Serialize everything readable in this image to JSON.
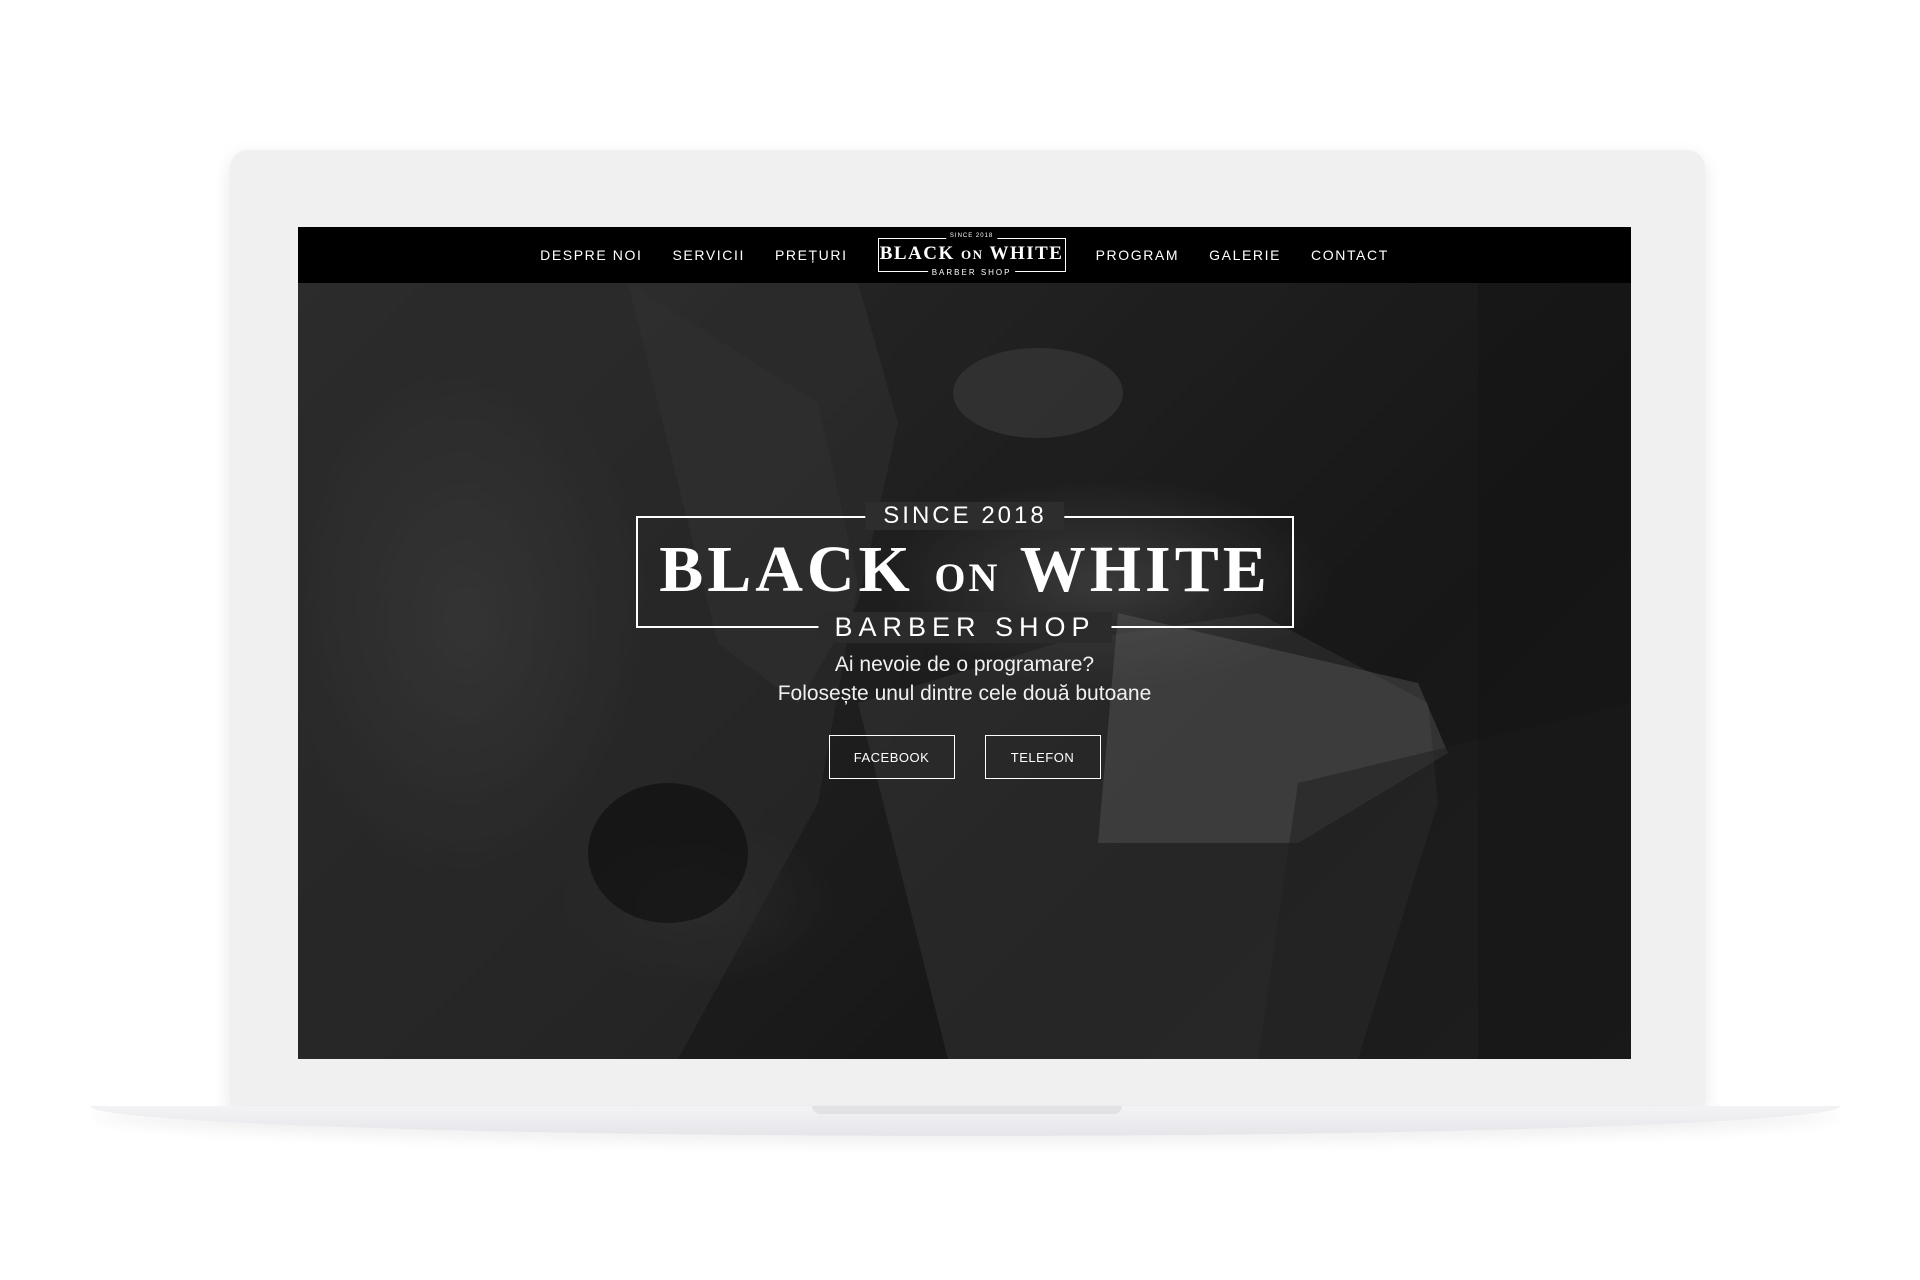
{
  "nav": {
    "left_links": [
      "DESPRE NOI",
      "SERVICII",
      "PREȚURI"
    ],
    "right_links": [
      "PROGRAM",
      "GALERIE",
      "CONTACT"
    ],
    "logo": {
      "since": "SINCE 2018",
      "word1": "BLACK",
      "word2": "ON",
      "word3": "WHITE",
      "sub": "BARBER SHOP"
    }
  },
  "hero": {
    "since": "SINCE 2018",
    "title_word1": "BLACK",
    "title_word2": "ON",
    "title_word3": "WHITE",
    "subtitle": "BARBER SHOP",
    "line1": "Ai nevoie de o programare?",
    "line2": "Folosește unul dintre cele două butoane",
    "buttons": {
      "facebook": "FACEBOOK",
      "telefon": "TELEFON"
    },
    "background": "black-and-white photo of a barber shaving a client with a hot towel"
  },
  "colors": {
    "nav_bg": "#000000",
    "text": "#ffffff",
    "frame": "#f0f0f0"
  }
}
